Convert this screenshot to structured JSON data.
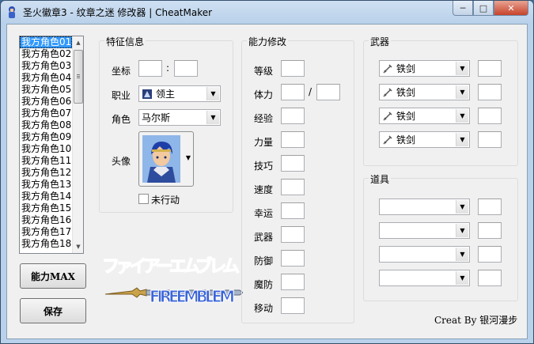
{
  "window": {
    "title": "圣火徽章3 - 纹章之迷 修改器 | CheatMaker",
    "minimize": "─",
    "maximize": "□",
    "close": "✕"
  },
  "roster": {
    "items": [
      "我方角色01",
      "我方角色02",
      "我方角色03",
      "我方角色04",
      "我方角色05",
      "我方角色06",
      "我方角色07",
      "我方角色08",
      "我方角色09",
      "我方角色10",
      "我方角色11",
      "我方角色12",
      "我方角色13",
      "我方角色14",
      "我方角色15",
      "我方角色16",
      "我方角色17",
      "我方角色18"
    ],
    "selected_index": 0
  },
  "buttons": {
    "max": "能力MAX",
    "save": "保存"
  },
  "traits": {
    "title": "特征信息",
    "coord_label": "坐标",
    "coord_sep": ":",
    "coord_x": "",
    "coord_y": "",
    "class_label": "职业",
    "class_value": "领主",
    "class_icon": "lord-icon",
    "character_label": "角色",
    "character_value": "马尔斯",
    "avatar_label": "头像",
    "not_moved_label": "未行动",
    "not_moved_checked": false
  },
  "abilities": {
    "title": "能力修改",
    "rows": [
      {
        "label": "等级",
        "value": ""
      },
      {
        "label": "体力",
        "value": "",
        "max_value": "",
        "sep": "/"
      },
      {
        "label": "经验",
        "value": ""
      },
      {
        "label": "力量",
        "value": ""
      },
      {
        "label": "技巧",
        "value": ""
      },
      {
        "label": "速度",
        "value": ""
      },
      {
        "label": "幸运",
        "value": ""
      },
      {
        "label": "武器",
        "value": ""
      },
      {
        "label": "防御",
        "value": ""
      },
      {
        "label": "魔防",
        "value": ""
      },
      {
        "label": "移动",
        "value": ""
      }
    ]
  },
  "weapons": {
    "title": "武器",
    "slots": [
      {
        "name": "铁剑",
        "icon": "sword-icon",
        "uses": ""
      },
      {
        "name": "铁剑",
        "icon": "sword-icon",
        "uses": ""
      },
      {
        "name": "铁剑",
        "icon": "sword-icon",
        "uses": ""
      },
      {
        "name": "铁剑",
        "icon": "sword-icon",
        "uses": ""
      }
    ]
  },
  "items": {
    "title": "道具",
    "slots": [
      {
        "name": "",
        "uses": ""
      },
      {
        "name": "",
        "uses": ""
      },
      {
        "name": "",
        "uses": ""
      },
      {
        "name": "",
        "uses": ""
      }
    ]
  },
  "logo": {
    "title": "ファイアーエムブレム",
    "subtitle": "FIREEMBLEM"
  },
  "credit": "Creat By 银河漫步",
  "colors": {
    "selection": "#3399ff",
    "logo_purple": "#8a4fc7",
    "logo_blue": "#2a5fd6"
  }
}
